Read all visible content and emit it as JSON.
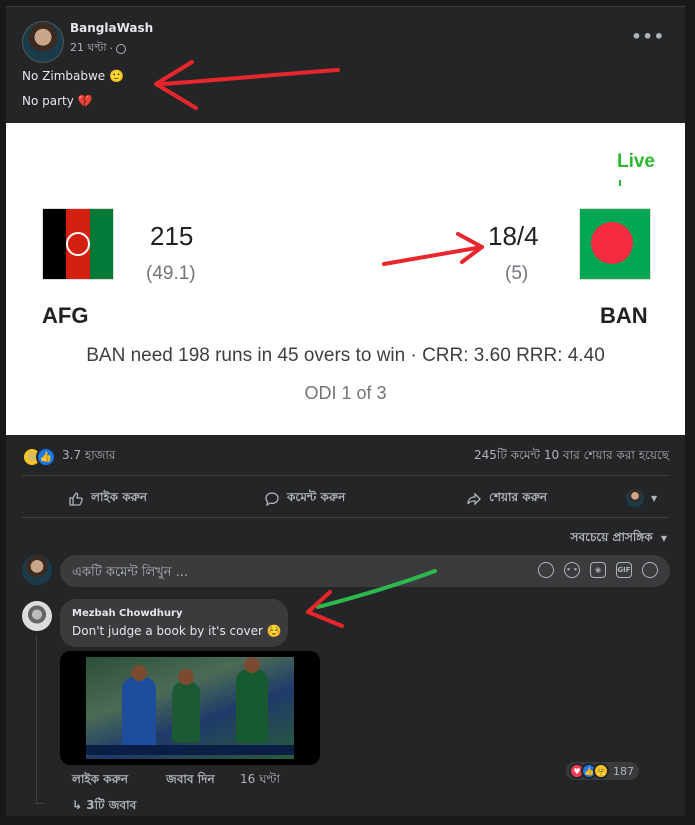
{
  "post": {
    "author": "BanglaWash",
    "time": "21 ঘণ্টা",
    "meta_sep": "·",
    "line1": "No Zimbabwe",
    "line1_emoji": "🙂",
    "line2": "No party",
    "line2_emoji": "💔",
    "more": "•••"
  },
  "scorecard": {
    "live": "Live",
    "team1": {
      "name": "AFG",
      "runs": "215",
      "overs": "(49.1)"
    },
    "team2": {
      "name": "BAN",
      "runs": "18/4",
      "overs": "(5)"
    },
    "status": "BAN need 198 runs in 45 overs to win · CRR: 3.60 RRR: 4.40",
    "series": "ODI 1 of 3"
  },
  "reactions": {
    "count": "3.7 হাজার",
    "stats": "245টি কমেন্ট  10 বার শেয়ার করা হয়েছে"
  },
  "actions": {
    "like": "লাইক করুন",
    "comment": "কমেন্ট করুন",
    "share": "শেয়ার করুন"
  },
  "sort": "সবচেয়ে প্রাসঙ্গিক",
  "comment_box": {
    "placeholder": "একটি কমেন্ট লিখুন ..."
  },
  "comment": {
    "author": "Mezbah Chowdhury",
    "text": "Don't judge a book by it's cover",
    "emoji": "☺️",
    "like": "লাইক করুন",
    "reply": "জবাব দিন",
    "time": "16 ঘণ্টা",
    "reaction_count": "187",
    "replies": "3টি জবাব"
  },
  "colors": {
    "live": "#2eb82e",
    "bg": "#242526",
    "annotation_red": "#e8262b",
    "annotation_green": "#2db84d"
  }
}
